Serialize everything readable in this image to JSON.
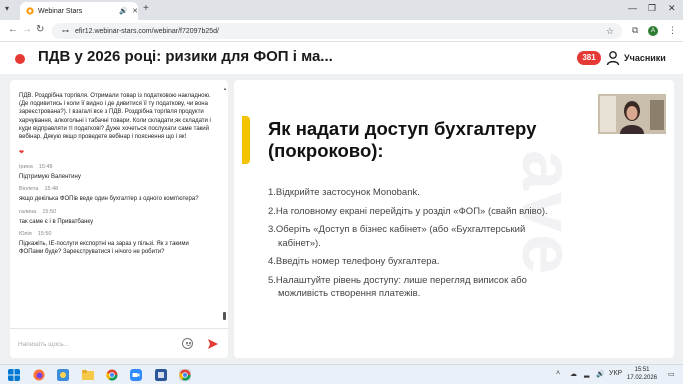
{
  "browser": {
    "tab_title": "Webinar Stars",
    "url": "efir12.webinar-stars.com/webinar/f72097b25d/",
    "profile_initial": "A"
  },
  "header": {
    "title": "ПДВ у 2026 році: ризики для ФОП і ма...",
    "participants_count": "381",
    "participants_label": "Учасники"
  },
  "chat": {
    "messages": [
      {
        "author": "",
        "time": "",
        "text": "ПДВ. Роздрібна торгівля. Отримали товар із податковою накладною.(Де подивитись і коли її видно і де дивитися її ту податкову, чи вона зареєстрована?). І взагалі все з ПДВ. Роздрібна торгівля продукти харчування, алкогольні і табачні товари. Коли складати,як складати і куди відправляти ті податкові? Дуже хочеться послухати саме такий вебінар. Дякую якщо проведете вебінар і пояснення що і як!",
        "has_heart": true
      },
      {
        "author": "Ірина",
        "time": "15:48",
        "text": "Підтримую Валентину"
      },
      {
        "author": "Віолета",
        "time": "15:48",
        "text": "якщо декілька ФОПів веде один бухгалтер з одного комп'ютера?"
      },
      {
        "author": "галина",
        "time": "15:50",
        "text": "так саме є і в Приватбанку"
      },
      {
        "author": "Юлія",
        "time": "15:50",
        "text": "Підкажіть, ІЕ-послуги експортні на зараз у пільзі. Як з такими ФОПами буде? Зареєструватися і нічого не робити?"
      }
    ],
    "input_placeholder": "Напишіть щось..."
  },
  "slide": {
    "title": "Як надати доступ бухгалтеру (покроково):",
    "watermark": "ave",
    "steps": [
      {
        "main": "1.Відкрийте застосунок Monobank."
      },
      {
        "main": "2.На головному екрані перейдіть у розділ «ФОП» (свайп вліво)."
      },
      {
        "main": "3.Оберіть «Доступ в бізнес кабінет» (або «Бухгалтерський",
        "cont": "кабінет»)."
      },
      {
        "main": "4.Введіть номер телефону бухгалтера."
      },
      {
        "main": "5.Налаштуйте рівень доступу: лише перегляд виписок або",
        "cont": "можливість створення платежів."
      }
    ]
  },
  "taskbar": {
    "lang": "УКР",
    "time": "15:51",
    "date": "17.02.2026"
  },
  "colors": {
    "accent_red": "#e53935",
    "slide_accent_yellow": "#f5c400"
  }
}
